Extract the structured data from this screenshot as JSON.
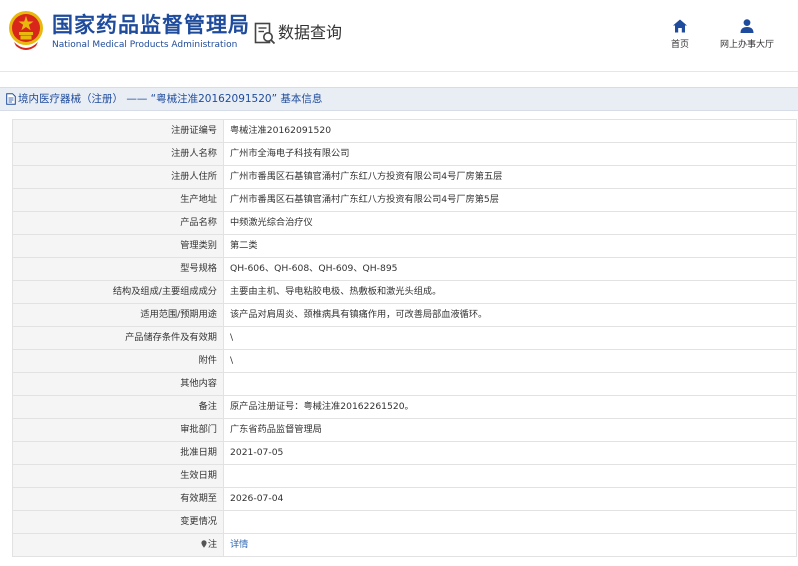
{
  "header": {
    "agency_name_cn": "国家药品监督管理局",
    "agency_name_en": "National Medical Products Administration",
    "query_title": "数据查询",
    "nav": [
      {
        "label": "首页",
        "icon": "home-icon"
      },
      {
        "label": "网上办事大厅",
        "icon": "user-icon"
      }
    ]
  },
  "title_bar": {
    "text": "境内医疗器械（注册） —— “粤械注准20162091520” 基本信息",
    "icon": "document-icon"
  },
  "rows": [
    {
      "label": "注册证编号",
      "value": "粤械注准20162091520"
    },
    {
      "label": "注册人名称",
      "value": "广州市全海电子科技有限公司"
    },
    {
      "label": "注册人住所",
      "value": "广州市番禺区石基镇官涌村广东红八方投资有限公司4号厂房第五层"
    },
    {
      "label": "生产地址",
      "value": "广州市番禺区石基镇官涌村广东红八方投资有限公司4号厂房第5层"
    },
    {
      "label": "产品名称",
      "value": "中频激光综合治疗仪"
    },
    {
      "label": "管理类别",
      "value": "第二类"
    },
    {
      "label": "型号规格",
      "value": "QH-606、QH-608、QH-609、QH-895"
    },
    {
      "label": "结构及组成/主要组成成分",
      "value": "主要由主机、导电粘胶电极、热敷板和激光头组成。"
    },
    {
      "label": "适用范围/预期用途",
      "value": "该产品对肩周炎、颈椎病具有镇痛作用，可改善局部血液循环。"
    },
    {
      "label": "产品储存条件及有效期",
      "value": "\\"
    },
    {
      "label": "附件",
      "value": "\\"
    },
    {
      "label": "其他内容",
      "value": ""
    },
    {
      "label": "备注",
      "value": "原产品注册证号：粤械注准20162261520。"
    },
    {
      "label": "审批部门",
      "value": "广东省药品监督管理局"
    },
    {
      "label": "批准日期",
      "value": "2021-07-05"
    },
    {
      "label": "生效日期",
      "value": ""
    },
    {
      "label": "有效期至",
      "value": "2026-07-04"
    },
    {
      "label": "变更情况",
      "value": ""
    },
    {
      "label": "注",
      "value": "详情",
      "link": true,
      "icon": "pin-icon"
    }
  ],
  "colors": {
    "brand_blue": "#1f4b9c",
    "link_blue": "#2a66b5",
    "emblem_red": "#d8261b",
    "emblem_gold": "#e9b80d"
  }
}
